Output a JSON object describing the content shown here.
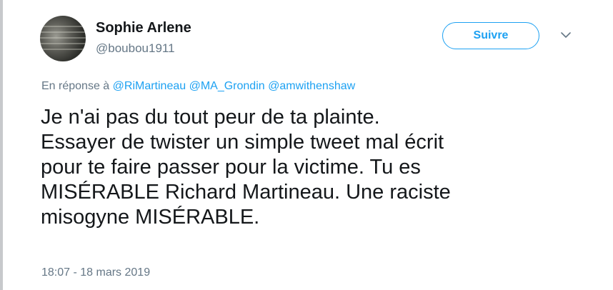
{
  "author": {
    "display_name": "Sophie Arlene",
    "handle": "@boubou1911"
  },
  "follow_button": {
    "label": "Suivre"
  },
  "reply": {
    "prefix": "En réponse à",
    "mentions": [
      "@RiMartineau",
      "@MA_Grondin",
      "@amwithenshaw"
    ]
  },
  "tweet": {
    "lines": [
      "Je n'ai pas du tout peur de ta plainte.",
      "Essayer de twister un simple tweet mal écrit",
      "pour te faire passer pour la victime. Tu es",
      "MISÉRABLE Richard Martineau. Une raciste",
      "misogyne MISÉRABLE."
    ],
    "timestamp": "18:07 - 18 mars 2019"
  },
  "colors": {
    "accent": "#1da1f2",
    "secondary_text": "#657786",
    "primary_text": "#14171a"
  },
  "icons": {
    "menu": "chevron-down-icon",
    "avatar": "profile-photo"
  }
}
